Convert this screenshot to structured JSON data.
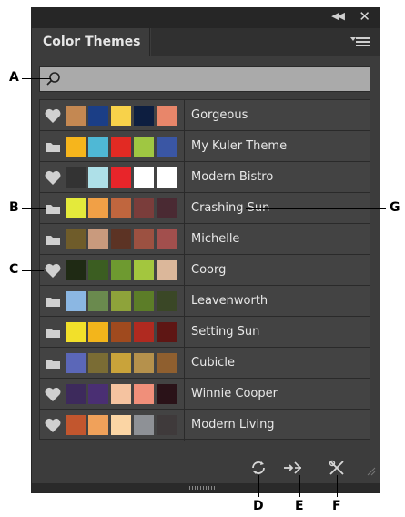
{
  "panel": {
    "title": "Color Themes",
    "colors": {
      "bg": "#3c3c3c",
      "row": "#434343",
      "border": "#2a2a2a",
      "search_bg": "#aaaaaa"
    }
  },
  "search": {
    "placeholder": "",
    "icon": "search-icon"
  },
  "themes": [
    {
      "name": "Gorgeous",
      "icon": "heart",
      "swatches": [
        "#c48852",
        "#1b3e86",
        "#f8d24a",
        "#0d1e40",
        "#e8866a"
      ]
    },
    {
      "name": "My Kuler Theme",
      "icon": "folder",
      "swatches": [
        "#f6b51c",
        "#4fb8d5",
        "#e22a23",
        "#9fc742",
        "#3a56a4"
      ]
    },
    {
      "name": "Modern Bistro",
      "icon": "heart",
      "swatches": [
        "#333333",
        "#aee0e8",
        "#e8252a",
        "#ffffff",
        "#ffffff"
      ]
    },
    {
      "name": "Crashing Sun",
      "icon": "folder",
      "swatches": [
        "#e4ea3b",
        "#f1a046",
        "#c0663e",
        "#7a3d3b",
        "#4a2a33"
      ]
    },
    {
      "name": "Michelle",
      "icon": "folder",
      "swatches": [
        "#6f5c2a",
        "#c99a7d",
        "#5c3324",
        "#9c5141",
        "#a24f4d"
      ]
    },
    {
      "name": "Coorg",
      "icon": "heart",
      "swatches": [
        "#1f2a14",
        "#3b5d21",
        "#6e9a30",
        "#a3c63e",
        "#dbb79a"
      ]
    },
    {
      "name": "Leavenworth",
      "icon": "folder",
      "swatches": [
        "#8bb7e3",
        "#6a8a4e",
        "#8ea33a",
        "#5c7d28",
        "#3a4726"
      ]
    },
    {
      "name": "Setting Sun",
      "icon": "folder",
      "swatches": [
        "#f2e02a",
        "#f3b51b",
        "#a04a1e",
        "#b02a20",
        "#5e1614"
      ]
    },
    {
      "name": "Cubicle",
      "icon": "folder",
      "swatches": [
        "#5b67b8",
        "#7a6c34",
        "#c9a33a",
        "#b5914c",
        "#8f5f2f"
      ]
    },
    {
      "name": "Winnie Cooper",
      "icon": "heart",
      "swatches": [
        "#3d2a5c",
        "#4a2f73",
        "#f5c3a0",
        "#f08f7a",
        "#2a1218"
      ]
    },
    {
      "name": "Modern Living",
      "icon": "heart",
      "swatches": [
        "#c2562e",
        "#f0a15a",
        "#fbd5a4",
        "#8e9196",
        "#3f3a3b"
      ]
    }
  ],
  "footer": {
    "buttons": [
      "refresh-icon",
      "add-to-swatches-icon",
      "tools-icon"
    ]
  },
  "callouts": {
    "a": "A",
    "b": "B",
    "c": "C",
    "d": "D",
    "e": "E",
    "f": "F",
    "g": "G"
  }
}
